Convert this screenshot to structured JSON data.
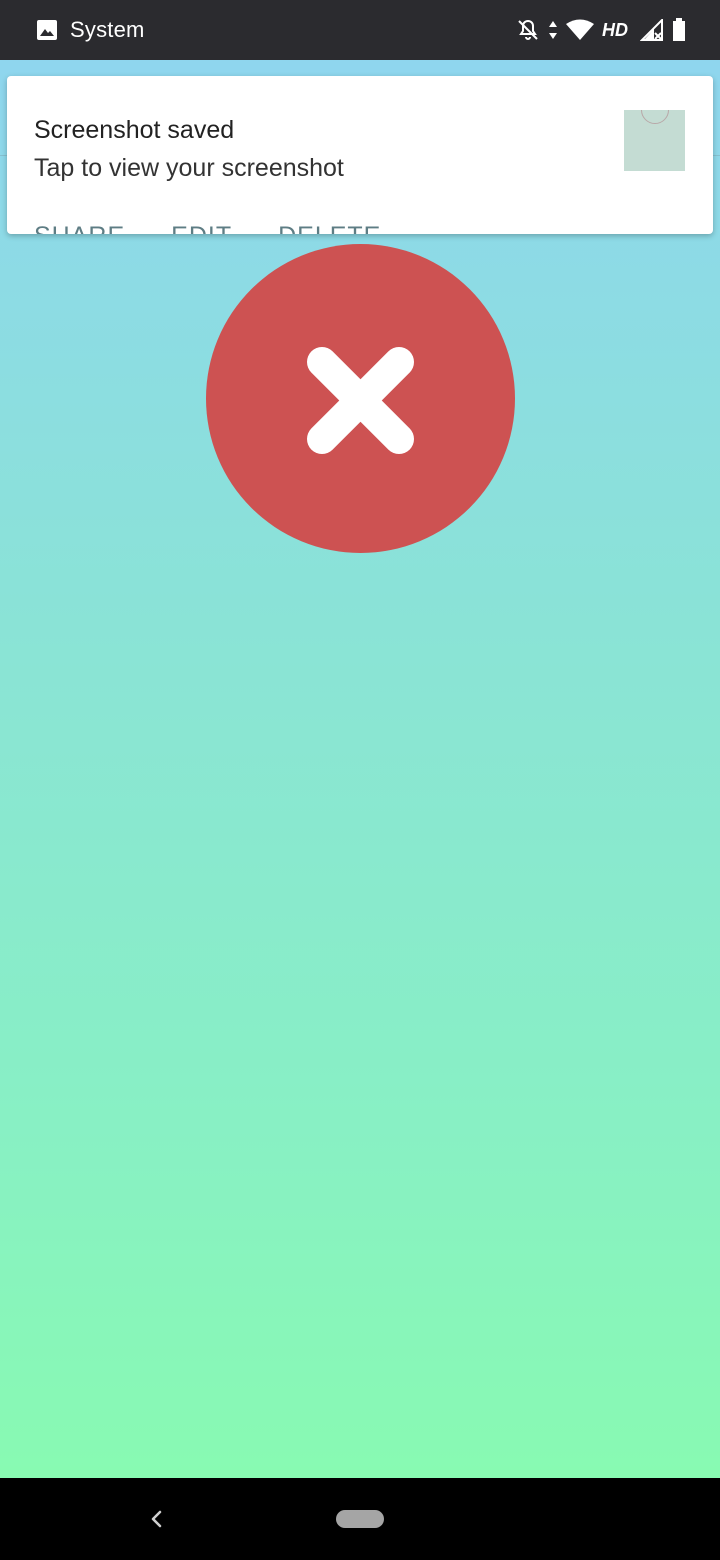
{
  "status_bar": {
    "app_name": "System",
    "network_label": "HD",
    "icons": [
      "image-icon",
      "notifications-off-icon",
      "data-arrows-icon",
      "wifi-icon",
      "cell-signal-icon",
      "battery-icon"
    ]
  },
  "notification": {
    "title": "Screenshot saved",
    "text": "Tap to view your screenshot",
    "actions": [
      "SHARE",
      "EDIT",
      "DELETE"
    ]
  },
  "main": {
    "status_icon": "close-icon",
    "status_color": "#cd5252"
  },
  "nav": {
    "icons": [
      "back-icon",
      "home-pill"
    ]
  }
}
